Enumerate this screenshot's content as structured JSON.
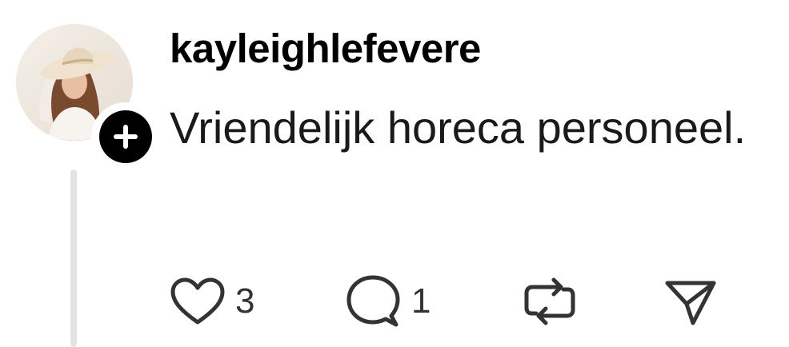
{
  "post": {
    "username": "kayleighlefevere",
    "text": "Vriendelijk horeca personeel.",
    "avatar_icon": "profile-photo",
    "follow_icon": "plus-icon",
    "colors": {
      "text": "#000000",
      "icon": "#333333",
      "thread_line": "#e3e3e3",
      "badge": "#000000"
    }
  },
  "actions": {
    "like": {
      "icon": "heart-icon",
      "count": "3"
    },
    "reply": {
      "icon": "comment-icon",
      "count": "1"
    },
    "repost": {
      "icon": "repost-icon"
    },
    "share": {
      "icon": "send-icon"
    }
  }
}
